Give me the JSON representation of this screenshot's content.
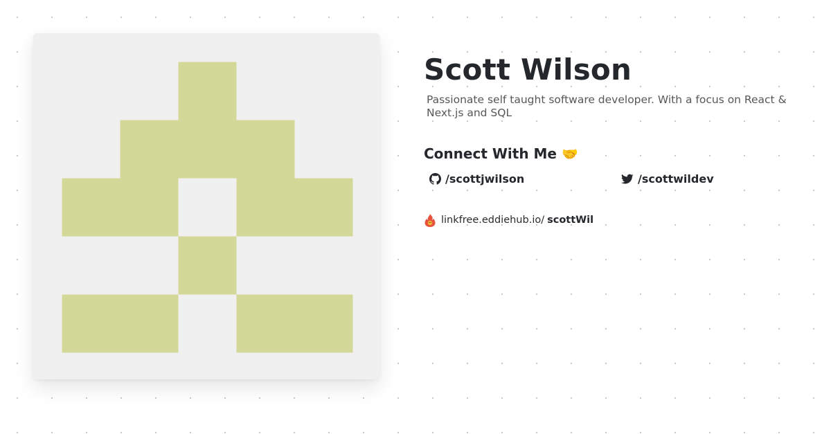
{
  "profile": {
    "name": "Scott Wilson",
    "bio": "Passionate self taught software developer. With a focus on React & Next.js and SQL"
  },
  "connect": {
    "title": "Connect With Me",
    "emoji": "🤝"
  },
  "socials": [
    {
      "platform": "github",
      "icon": "github-icon",
      "handle": "/scottjwilson"
    },
    {
      "platform": "twitter",
      "icon": "twitter-icon",
      "handle": "/scottwildev"
    }
  ],
  "linkfree": {
    "icon": "linkfree-logo-icon",
    "host": "linkfree.eddiehub.io/",
    "username": "scottWil"
  },
  "avatar": {
    "background_color": "#f0f0f0",
    "tile_color": "#d3d898",
    "pattern": [
      [
        0,
        0,
        1,
        0,
        0
      ],
      [
        0,
        1,
        1,
        1,
        0
      ],
      [
        1,
        1,
        0,
        1,
        1
      ],
      [
        0,
        0,
        1,
        0,
        0
      ],
      [
        1,
        1,
        0,
        1,
        1
      ]
    ]
  }
}
